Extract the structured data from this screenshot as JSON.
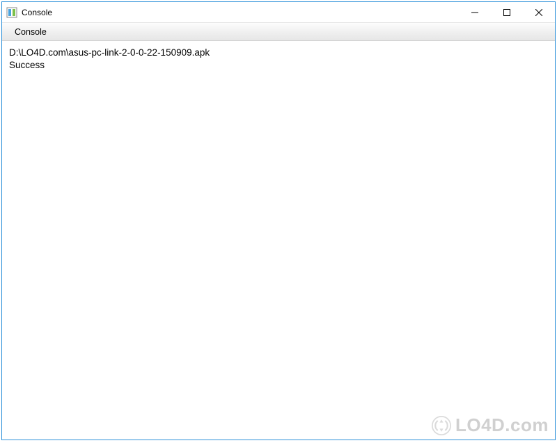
{
  "titlebar": {
    "title": "Console"
  },
  "menubar": {
    "items": [
      {
        "label": "Console"
      }
    ]
  },
  "content": {
    "line1": "D:\\LO4D.com\\asus-pc-link-2-0-0-22-150909.apk",
    "line2": "Success"
  },
  "watermark": {
    "text": "LO4D.com"
  }
}
